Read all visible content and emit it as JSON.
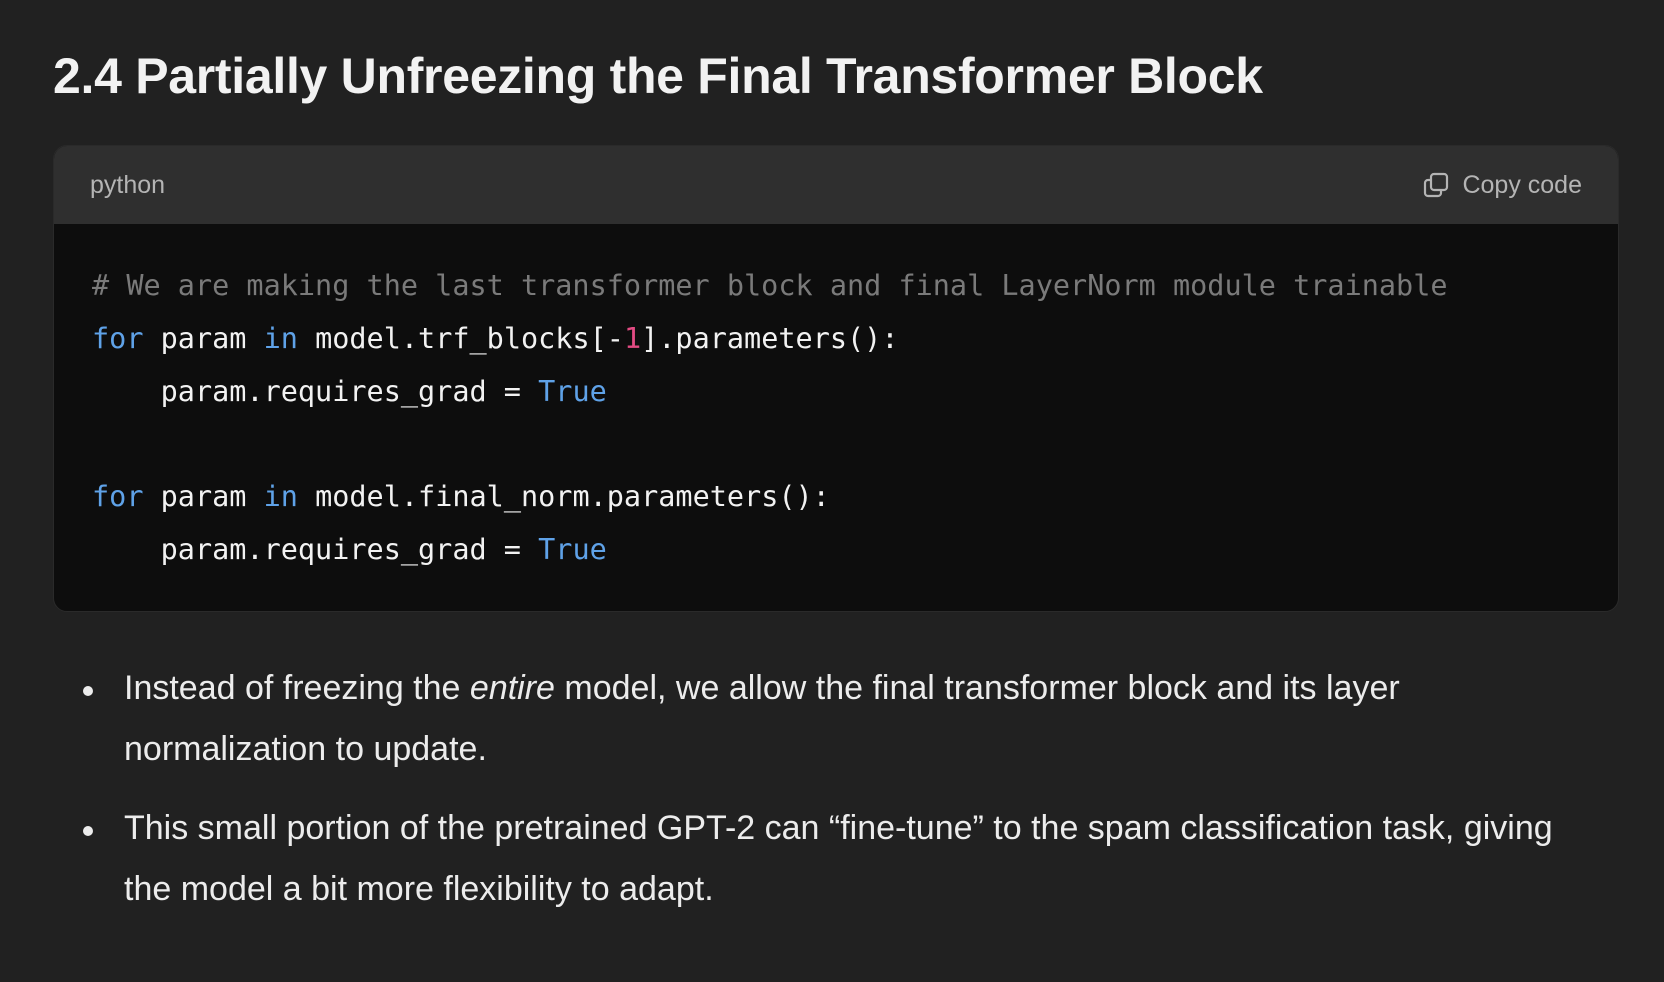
{
  "section": {
    "title": "2.4 Partially Unfreezing the Final Transformer Block"
  },
  "code_block": {
    "language": "python",
    "copy_label": "Copy code",
    "copy_icon": "copy-icon",
    "lines": [
      [
        {
          "t": "comment",
          "v": "# We are making the last transformer block and final LayerNorm module trainable"
        }
      ],
      [
        {
          "t": "keyword",
          "v": "for"
        },
        {
          "t": "plain",
          "v": " param "
        },
        {
          "t": "keyword",
          "v": "in"
        },
        {
          "t": "plain",
          "v": " model.trf_blocks[-"
        },
        {
          "t": "number",
          "v": "1"
        },
        {
          "t": "plain",
          "v": "].parameters():"
        }
      ],
      [
        {
          "t": "plain",
          "v": "    param.requires_grad = "
        },
        {
          "t": "bool",
          "v": "True"
        }
      ],
      [],
      [
        {
          "t": "keyword",
          "v": "for"
        },
        {
          "t": "plain",
          "v": " param "
        },
        {
          "t": "keyword",
          "v": "in"
        },
        {
          "t": "plain",
          "v": " model.final_norm.parameters():"
        }
      ],
      [
        {
          "t": "plain",
          "v": "    param.requires_grad = "
        },
        {
          "t": "bool",
          "v": "True"
        }
      ]
    ]
  },
  "bullets": [
    {
      "before": "Instead of freezing the ",
      "emphasis": "entire",
      "after": " model, we allow the final transformer block and its layer normalization to update."
    },
    {
      "before": "This small portion of the pretrained GPT-2 can “fine-tune” to the spam classification task, giving the model a bit more flexibility to adapt.",
      "emphasis": "",
      "after": ""
    }
  ],
  "colors": {
    "background": "#212121",
    "code_background": "#0d0d0d",
    "code_header": "#2f2f2f",
    "keyword": "#5fa2e8",
    "number": "#e34b83",
    "comment": "#7a7a7a"
  }
}
